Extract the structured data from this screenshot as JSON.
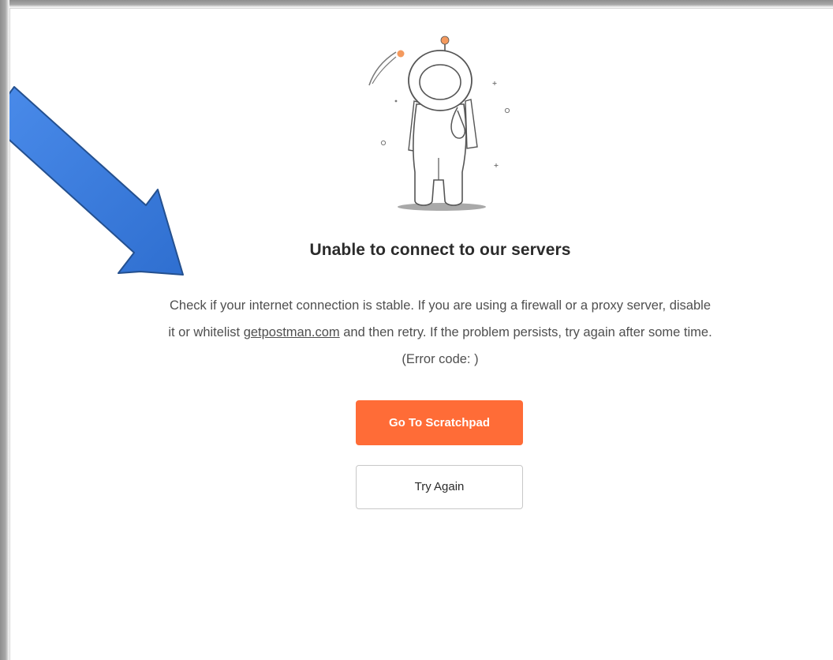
{
  "error": {
    "title": "Unable to connect to our servers",
    "message_part1": "Check if your internet connection is stable. If you are using a firewall or a proxy server, disable it or whitelist ",
    "link_text": "getpostman.com",
    "message_part2": " and then retry. If the problem persists, try again after some time. (Error code: )"
  },
  "actions": {
    "scratchpad_label": "Go To Scratchpad",
    "try_again_label": "Try Again"
  },
  "colors": {
    "accent": "#ff6c37",
    "annotation_arrow": "#3b7ddd"
  },
  "icons": {
    "illustration": "astronaut-illustration",
    "annotation": "arrow-pointer-icon"
  }
}
